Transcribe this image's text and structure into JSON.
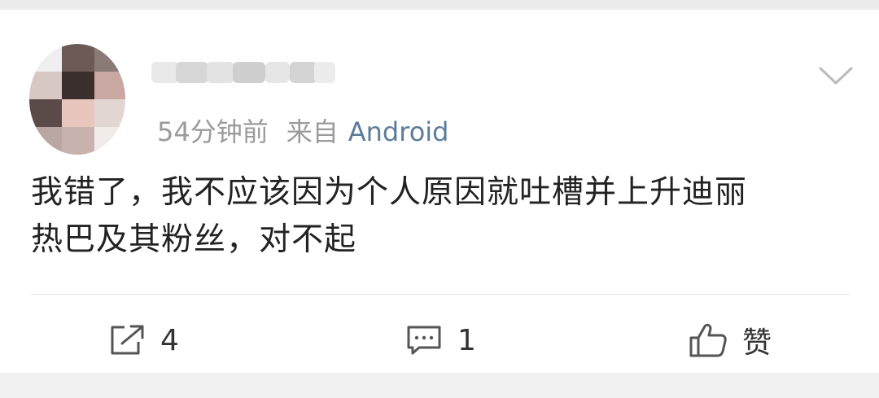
{
  "post": {
    "time": "54分钟前",
    "source_prefix": "来自",
    "source": "Android",
    "text_line1": "我错了，我不应该因为个人原因就吐槽并上升迪丽",
    "text_line2": "热巴及其粉丝，对不起"
  },
  "actions": {
    "repost_count": "4",
    "comment_count": "1",
    "like_label": "赞"
  },
  "icons": {
    "menu": "chevron-down-icon",
    "repost": "share-icon",
    "comment": "comment-icon",
    "like": "thumbs-up-icon"
  },
  "colors": {
    "meta": "#9b9b9b",
    "source": "#5c7c9a",
    "text": "#222222"
  }
}
